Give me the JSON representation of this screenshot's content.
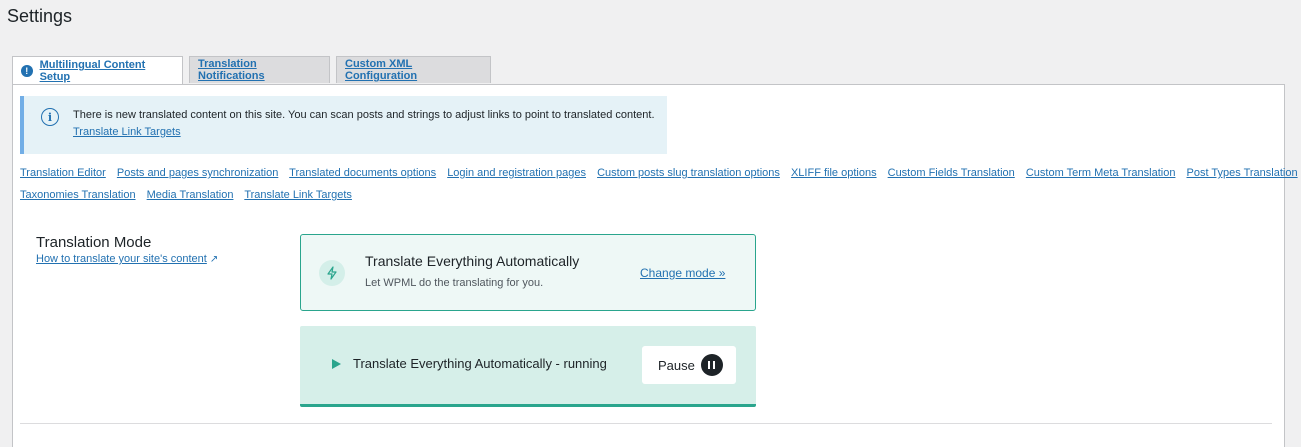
{
  "page": {
    "title": "Settings"
  },
  "tabs": [
    {
      "label": "Multilingual Content Setup",
      "active": true,
      "icon": "alert-icon"
    },
    {
      "label": "Translation Notifications",
      "active": false
    },
    {
      "label": "Custom XML Configuration",
      "active": false
    }
  ],
  "notice": {
    "icon": "info-icon",
    "message": "There is new translated content on this site. You can scan posts and strings to adjust links to point to translated content.",
    "link": "Translate Link Targets"
  },
  "subnav": {
    "row1": [
      "Translation Editor",
      "Posts and pages synchronization",
      "Translated documents options",
      "Login and registration pages",
      "Custom posts slug translation options",
      "XLIFF file options",
      "Custom Fields Translation",
      "Custom Term Meta Translation",
      "Post Types Translation"
    ],
    "row2": [
      "Taxonomies Translation",
      "Media Translation",
      "Translate Link Targets"
    ]
  },
  "translation_mode": {
    "heading": "Translation Mode",
    "help_link": "How to translate your site's content",
    "card": {
      "icon": "bolt-icon",
      "title": "Translate Everything Automatically",
      "subtitle": "Let WPML do the translating for you.",
      "change_link": "Change mode »"
    },
    "status": {
      "icon": "play-icon",
      "text": "Translate Everything Automatically - running",
      "pause_label": "Pause"
    }
  },
  "colors": {
    "link": "#2271b1",
    "accent": "#2aa58d",
    "notice_bg": "#e5f2f7",
    "card_bg": "#eef8f6",
    "status_bg": "#d6efe9"
  }
}
